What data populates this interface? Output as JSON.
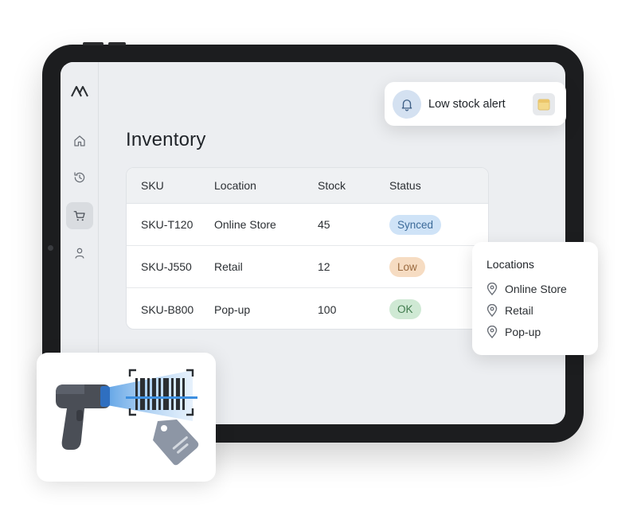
{
  "nav": {
    "items": [
      {
        "name": "home",
        "icon": "home-icon"
      },
      {
        "name": "history",
        "icon": "history-icon"
      },
      {
        "name": "cart",
        "icon": "cart-icon",
        "active": true
      },
      {
        "name": "profile",
        "icon": "user-icon"
      }
    ],
    "logo_icon": "logo-icon"
  },
  "page": {
    "title": "Inventory"
  },
  "table": {
    "headers": {
      "sku": "SKU",
      "location": "Location",
      "stock": "Stock",
      "status": "Status"
    },
    "rows": [
      {
        "sku": "SKU-T120",
        "location": "Online Store",
        "stock": "45",
        "status": "Synced"
      },
      {
        "sku": "SKU-J550",
        "location": "Retail",
        "stock": "12",
        "status": "Low"
      },
      {
        "sku": "SKU-B800",
        "location": "Pop-up",
        "stock": "100",
        "status": "OK"
      }
    ]
  },
  "alert": {
    "text": "Low stock alert",
    "icon": "bell-icon",
    "action_icon": "calendar-icon"
  },
  "locations_panel": {
    "title": "Locations",
    "items": [
      "Online Store",
      "Retail",
      "Pop-up"
    ],
    "icon": "map-pin-icon"
  },
  "illustration": {
    "icons": [
      "barcode-scanner-icon",
      "barcode-icon",
      "price-tag-icon"
    ]
  },
  "colors": {
    "synced_bg": "#cfe3f7",
    "low_bg": "#f6dcc2",
    "ok_bg": "#cfe9d4",
    "scan_beam": "#3d8fe0",
    "device": "#1c1d1f"
  }
}
